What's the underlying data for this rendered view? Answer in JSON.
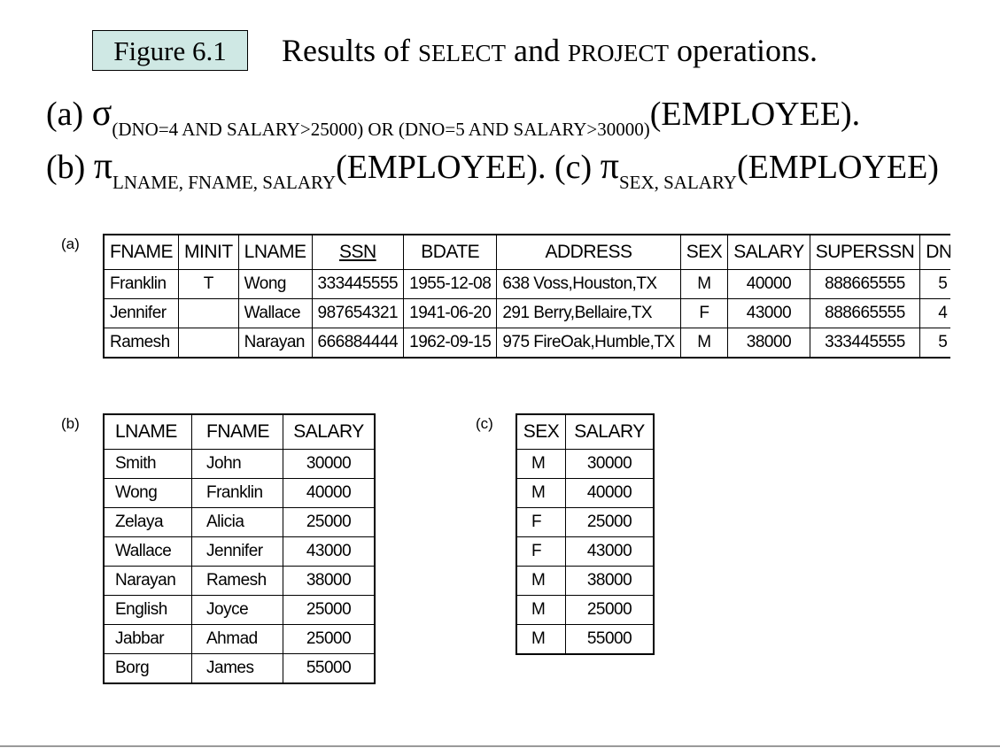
{
  "figure_label": "Figure 6.1",
  "caption": {
    "pre": "Results of ",
    "select": "SELECT",
    "mid": " and ",
    "project": "PROJECT",
    "post": " operations."
  },
  "expr_a": {
    "label": "(a) ",
    "op": "σ",
    "sub": "(DNO=4 AND SALARY>25000) OR (DNO=5 AND SALARY>30000)",
    "rel": "(EMPLOYEE)."
  },
  "expr_b": {
    "label": "(b) ",
    "op": "π",
    "sub": "LNAME, FNAME, SALARY",
    "rel": "(EMPLOYEE). "
  },
  "expr_c": {
    "label": "(c) ",
    "op": "π",
    "sub": "SEX, SALARY",
    "rel": "(EMPLOYEE)"
  },
  "table_a": {
    "label": "(a)",
    "headers": [
      "FNAME",
      "MINIT",
      "LNAME",
      "SSN",
      "BDATE",
      "ADDRESS",
      "SEX",
      "SALARY",
      "SUPERSSN",
      "DNO"
    ],
    "rows": [
      [
        "Franklin",
        "T",
        "Wong",
        "333445555",
        "1955-12-08",
        "638 Voss,Houston,TX",
        "M",
        "40000",
        "888665555",
        "5"
      ],
      [
        "Jennifer",
        "",
        "Wallace",
        "987654321",
        "1941-06-20",
        "291 Berry,Bellaire,TX",
        "F",
        "43000",
        "888665555",
        "4"
      ],
      [
        "Ramesh",
        "",
        "Narayan",
        "666884444",
        "1962-09-15",
        "975 FireOak,Humble,TX",
        "M",
        "38000",
        "333445555",
        "5"
      ]
    ]
  },
  "table_b": {
    "label": "(b)",
    "headers": [
      "LNAME",
      "FNAME",
      "SALARY"
    ],
    "rows": [
      [
        "Smith",
        "John",
        "30000"
      ],
      [
        "Wong",
        "Franklin",
        "40000"
      ],
      [
        "Zelaya",
        "Alicia",
        "25000"
      ],
      [
        "Wallace",
        "Jennifer",
        "43000"
      ],
      [
        "Narayan",
        "Ramesh",
        "38000"
      ],
      [
        "English",
        "Joyce",
        "25000"
      ],
      [
        "Jabbar",
        "Ahmad",
        "25000"
      ],
      [
        "Borg",
        "James",
        "55000"
      ]
    ]
  },
  "table_c": {
    "label": "(c)",
    "headers": [
      "SEX",
      "SALARY"
    ],
    "rows": [
      [
        "M",
        "30000"
      ],
      [
        "M",
        "40000"
      ],
      [
        "F",
        "25000"
      ],
      [
        "F",
        "43000"
      ],
      [
        "M",
        "38000"
      ],
      [
        "M",
        "25000"
      ],
      [
        "M",
        "55000"
      ]
    ]
  }
}
